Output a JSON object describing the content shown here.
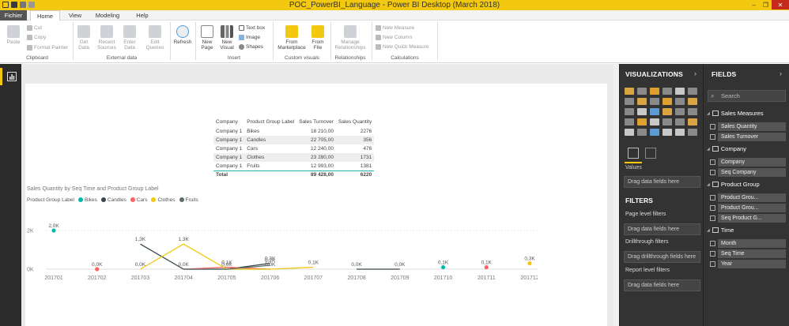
{
  "window": {
    "title": "POC_PowerBI_Language - Power BI Desktop (March 2018)"
  },
  "tabs": [
    "Fichier",
    "Home",
    "View",
    "Modeling",
    "Help"
  ],
  "ribbon": {
    "clipboard": {
      "paste": "Paste",
      "cut": "Cut",
      "copy": "Copy",
      "format_painter": "Format Painter",
      "label": "Clipboard"
    },
    "external": {
      "get_data": [
        "Get",
        "Data"
      ],
      "recent": [
        "Recent",
        "Sources"
      ],
      "enter": [
        "Enter",
        "Data"
      ],
      "edit": [
        "Edit",
        "Queries"
      ],
      "label": "External data"
    },
    "refresh": "Refresh",
    "insert": {
      "new_page": [
        "New",
        "Page"
      ],
      "new_visual": [
        "New",
        "Visual"
      ],
      "text_box": "Text box",
      "image": "Image",
      "shapes": "Shapes",
      "label": "Insert"
    },
    "custom": {
      "marketplace": [
        "From",
        "Marketplace"
      ],
      "file": [
        "From",
        "File"
      ],
      "label": "Custom visuals"
    },
    "relationships": {
      "manage": [
        "Manage",
        "Relationships"
      ],
      "label": "Relationships"
    },
    "calculations": {
      "new_measure": "New Measure",
      "new_column": "New Column",
      "new_quick": "New Quick Measure",
      "label": "Calculations"
    }
  },
  "visualizations": {
    "header": "VISUALIZATIONS",
    "values_label": "Values",
    "drag": "Drag data fields here",
    "filters_header": "FILTERS",
    "page_filters": "Page level filters",
    "drillthrough": "Drillthrough filters",
    "drag_drill": "Drag drillthrough fields here",
    "report_filters": "Report level filters"
  },
  "fields": {
    "header": "FIELDS",
    "search_placeholder": "Search",
    "groups": [
      {
        "name": "Sales Measures",
        "items": [
          "Sales Quantity",
          "Sales Turnover"
        ]
      },
      {
        "name": "Company",
        "items": [
          "Company",
          "Seq Company"
        ]
      },
      {
        "name": "Product Group",
        "items": [
          "Product Grou...",
          "Product Grou...",
          "Seq Product G..."
        ]
      },
      {
        "name": "Time",
        "items": [
          "Month",
          "Seq Time",
          "Year"
        ]
      }
    ]
  },
  "table": {
    "headers": [
      "Company",
      "Product Group Label",
      "Sales Turnover",
      "Sales Quantity"
    ],
    "rows": [
      [
        "Company 1",
        "Bikes",
        "18 210,00",
        "2276"
      ],
      [
        "Company 1",
        "Candles",
        "22 705,00",
        "356"
      ],
      [
        "Company 1",
        "Cars",
        "12 240,00",
        "476"
      ],
      [
        "Company 1",
        "Clothes",
        "23 280,00",
        "1731"
      ],
      [
        "Company 1",
        "Fruits",
        "12 993,00",
        "1381"
      ]
    ],
    "total": [
      "Total",
      "",
      "89 428,00",
      "6220"
    ]
  },
  "chart_data": {
    "type": "line",
    "title": "Sales Quantity by Seq Time and Product Group Label",
    "legend_title": "Product Group Label",
    "categories": [
      "201701",
      "201702",
      "201703",
      "201704",
      "201705",
      "201706",
      "201707",
      "201708",
      "201709",
      "201710",
      "201711",
      "201712"
    ],
    "y_ticks": [
      "2K",
      "0K"
    ],
    "ylim": [
      0,
      2000
    ],
    "series": [
      {
        "name": "Bikes",
        "color": "#01b8aa",
        "values": [
          2000,
          null,
          null,
          0,
          0,
          0,
          null,
          null,
          null,
          100,
          null,
          null
        ]
      },
      {
        "name": "Candles",
        "color": "#374649",
        "values": [
          null,
          null,
          1300,
          0,
          0,
          300,
          null,
          0,
          0,
          null,
          null,
          null
        ]
      },
      {
        "name": "Cars",
        "color": "#fd625e",
        "values": [
          null,
          0,
          null,
          0,
          100,
          0,
          null,
          null,
          null,
          null,
          100,
          null
        ]
      },
      {
        "name": "Clothes",
        "color": "#f2c80f",
        "values": [
          null,
          null,
          0,
          1300,
          0,
          0,
          100,
          null,
          null,
          null,
          null,
          300
        ]
      },
      {
        "name": "Fruits",
        "color": "#5f6b6d",
        "values": [
          null,
          null,
          null,
          0,
          0,
          200,
          null,
          null,
          null,
          null,
          null,
          null
        ]
      }
    ],
    "data_labels": [
      {
        "cat": 0,
        "text": "2,0K",
        "value": 2000
      },
      {
        "cat": 1,
        "text": "0,0K",
        "value": 0
      },
      {
        "cat": 2,
        "text": "1,3K",
        "value": 1300
      },
      {
        "cat": 2,
        "text": "0,0K",
        "value": 0
      },
      {
        "cat": 3,
        "text": "1,3K",
        "value": 1300
      },
      {
        "cat": 3,
        "text": "0,0K",
        "value": 0
      },
      {
        "cat": 4,
        "text": "0,1K",
        "value": 100
      },
      {
        "cat": 4,
        "text": "0,0K",
        "value": 0
      },
      {
        "cat": 5,
        "text": "0,3K",
        "value": 300
      },
      {
        "cat": 5,
        "text": "0,2K",
        "value": 200
      },
      {
        "cat": 5,
        "text": "0,0K",
        "value": 0
      },
      {
        "cat": 6,
        "text": "0,1K",
        "value": 100
      },
      {
        "cat": 7,
        "text": "0,0K",
        "value": 0
      },
      {
        "cat": 8,
        "text": "0,0K",
        "value": 0
      },
      {
        "cat": 9,
        "text": "0,1K",
        "value": 100
      },
      {
        "cat": 10,
        "text": "0,1K",
        "value": 100
      },
      {
        "cat": 11,
        "text": "0,3K",
        "value": 300
      }
    ]
  }
}
